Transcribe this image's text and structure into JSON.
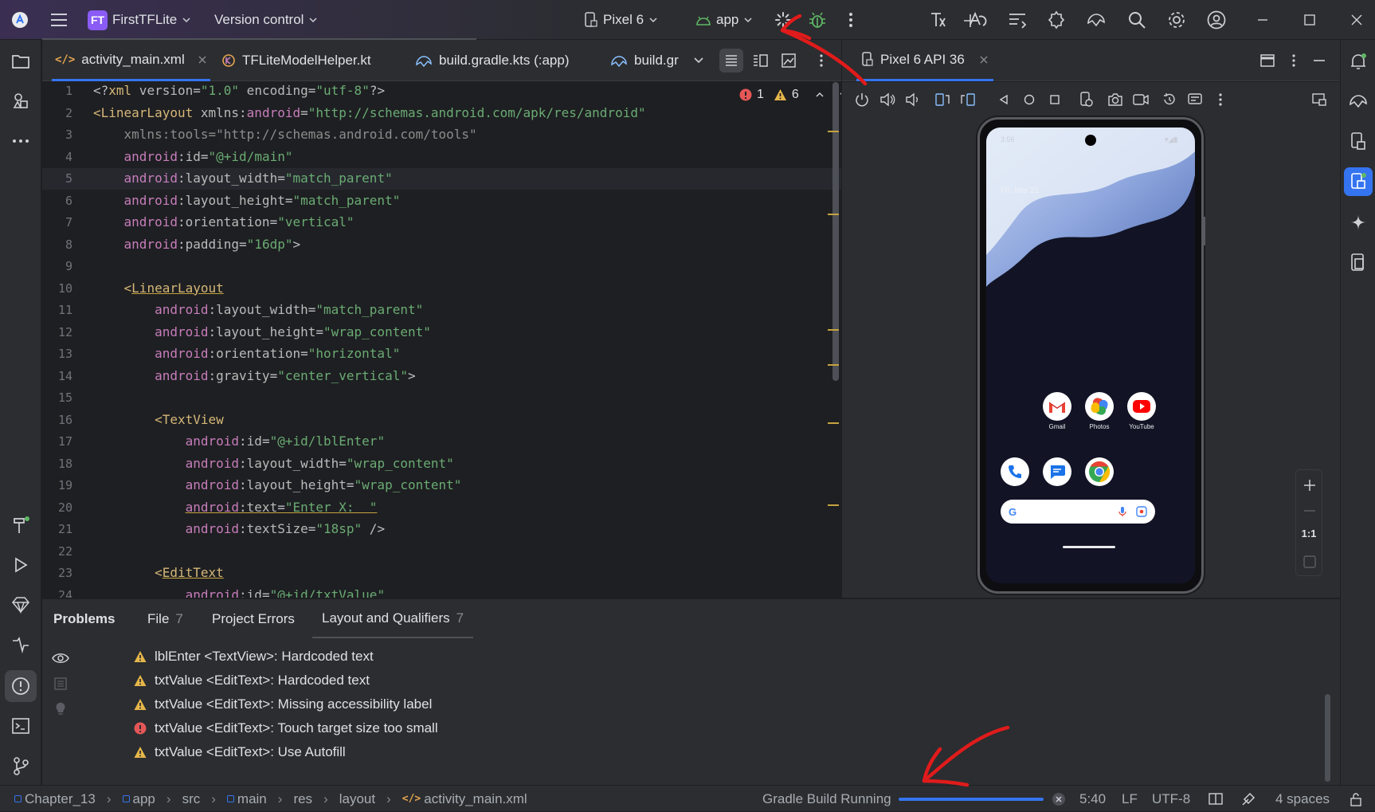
{
  "title_bar": {
    "project_badge": "FT",
    "project_name": "FirstTFLite",
    "vcs_label": "Version control",
    "device_label": "Pixel 6",
    "run_config_label": "app"
  },
  "editor": {
    "tabs": [
      {
        "label": "activity_main.xml",
        "active": true
      },
      {
        "label": "TFLiteModelHelper.kt",
        "active": false
      },
      {
        "label": "build.gradle.kts (:app)",
        "active": false
      },
      {
        "label": "build.gr",
        "active": false
      }
    ],
    "error_count": "1",
    "warning_count": "6",
    "lines": [
      {
        "n": "1",
        "segs": [
          [
            "p",
            "<?"
          ],
          [
            "t",
            "xml"
          ],
          [
            "a",
            " version"
          ],
          [
            "p",
            "="
          ],
          [
            "s",
            "\"1.0\""
          ],
          [
            "a",
            " encoding"
          ],
          [
            "p",
            "="
          ],
          [
            "s",
            "\"utf-8\""
          ],
          [
            "p",
            "?>"
          ]
        ]
      },
      {
        "n": "2",
        "segs": [
          [
            "t",
            "<LinearLayout"
          ],
          [
            "a",
            " xmlns:"
          ],
          [
            "ns",
            "android"
          ],
          [
            "p",
            "="
          ],
          [
            "s",
            "\"http://schemas.android.com/apk/res/android\""
          ]
        ]
      },
      {
        "n": "3",
        "segs": [
          [
            "g",
            "    xmlns:tools=\"http://schemas.android.com/tools\""
          ]
        ]
      },
      {
        "n": "4",
        "segs": [
          [
            "ns",
            "    android"
          ],
          [
            "a",
            ":id"
          ],
          [
            "p",
            "="
          ],
          [
            "s",
            "\"@+id/main\""
          ]
        ]
      },
      {
        "n": "5",
        "segs": [
          [
            "ns",
            "    android"
          ],
          [
            "a",
            ":layout_width"
          ],
          [
            "p",
            "="
          ],
          [
            "s",
            "\"match_parent\""
          ]
        ]
      },
      {
        "n": "6",
        "segs": [
          [
            "ns",
            "    android"
          ],
          [
            "a",
            ":layout_height"
          ],
          [
            "p",
            "="
          ],
          [
            "s",
            "\"match_parent\""
          ]
        ]
      },
      {
        "n": "7",
        "segs": [
          [
            "ns",
            "    android"
          ],
          [
            "a",
            ":orientation"
          ],
          [
            "p",
            "="
          ],
          [
            "s",
            "\"vertical\""
          ]
        ]
      },
      {
        "n": "8",
        "segs": [
          [
            "ns",
            "    android"
          ],
          [
            "a",
            ":padding"
          ],
          [
            "p",
            "="
          ],
          [
            "s",
            "\"16dp\""
          ],
          [
            "p",
            ">"
          ]
        ]
      },
      {
        "n": "9",
        "segs": []
      },
      {
        "n": "10",
        "segs": [
          [
            "t",
            "    <"
          ],
          [
            "tu",
            "LinearLayout"
          ]
        ]
      },
      {
        "n": "11",
        "segs": [
          [
            "ns",
            "        android"
          ],
          [
            "a",
            ":layout_width"
          ],
          [
            "p",
            "="
          ],
          [
            "s",
            "\"match_parent\""
          ]
        ]
      },
      {
        "n": "12",
        "segs": [
          [
            "ns",
            "        android"
          ],
          [
            "a",
            ":layout_height"
          ],
          [
            "p",
            "="
          ],
          [
            "s",
            "\"wrap_content\""
          ]
        ]
      },
      {
        "n": "13",
        "segs": [
          [
            "ns",
            "        android"
          ],
          [
            "a",
            ":orientation"
          ],
          [
            "p",
            "="
          ],
          [
            "s",
            "\"horizontal\""
          ]
        ]
      },
      {
        "n": "14",
        "segs": [
          [
            "ns",
            "        android"
          ],
          [
            "a",
            ":gravity"
          ],
          [
            "p",
            "="
          ],
          [
            "s",
            "\"center_vertical\""
          ],
          [
            "p",
            ">"
          ]
        ]
      },
      {
        "n": "15",
        "segs": []
      },
      {
        "n": "16",
        "segs": [
          [
            "t",
            "        <TextView"
          ]
        ]
      },
      {
        "n": "17",
        "segs": [
          [
            "ns",
            "            android"
          ],
          [
            "a",
            ":id"
          ],
          [
            "p",
            "="
          ],
          [
            "s",
            "\"@+id/lblEnter\""
          ]
        ]
      },
      {
        "n": "18",
        "segs": [
          [
            "ns",
            "            android"
          ],
          [
            "a",
            ":layout_width"
          ],
          [
            "p",
            "="
          ],
          [
            "s",
            "\"wrap_content\""
          ]
        ]
      },
      {
        "n": "19",
        "segs": [
          [
            "ns",
            "            android"
          ],
          [
            "a",
            ":layout_height"
          ],
          [
            "p",
            "="
          ],
          [
            "s",
            "\"wrap_content\""
          ]
        ]
      },
      {
        "n": "20",
        "segs": [
          [
            "p",
            "            "
          ],
          [
            "nsu",
            "android"
          ],
          [
            "au",
            ":text"
          ],
          [
            "pu",
            "="
          ],
          [
            "su",
            "\"Enter X:  \""
          ]
        ]
      },
      {
        "n": "21",
        "segs": [
          [
            "ns",
            "            android"
          ],
          [
            "a",
            ":textSize"
          ],
          [
            "p",
            "="
          ],
          [
            "s",
            "\"18sp\""
          ],
          [
            "p",
            " />"
          ]
        ]
      },
      {
        "n": "22",
        "segs": []
      },
      {
        "n": "23",
        "segs": [
          [
            "t",
            "        <"
          ],
          [
            "tu",
            "EditText"
          ]
        ]
      },
      {
        "n": "24",
        "segs": [
          [
            "ns",
            "            android"
          ],
          [
            "a",
            ":id"
          ],
          [
            "p",
            "="
          ],
          [
            "s",
            "\"@+id/txtValue\""
          ]
        ]
      }
    ]
  },
  "emulator": {
    "tab_label": "Pixel 6 API 36",
    "phone_date": "Fri, Mar 21",
    "phone_time": "3:56",
    "apps_row1": [
      "Gmail",
      "Photos",
      "YouTube"
    ],
    "zoom_label": "1:1"
  },
  "problems": {
    "tabs": [
      {
        "label": "Problems",
        "count": ""
      },
      {
        "label": "File",
        "count": "7"
      },
      {
        "label": "Project Errors",
        "count": ""
      },
      {
        "label": "Layout and Qualifiers",
        "count": "7"
      }
    ],
    "items": [
      {
        "severity": "warning",
        "text": "lblEnter <TextView>: Hardcoded text"
      },
      {
        "severity": "warning",
        "text": "txtValue <EditText>: Hardcoded text"
      },
      {
        "severity": "warning",
        "text": "txtValue <EditText>: Missing accessibility label"
      },
      {
        "severity": "error",
        "text": "txtValue <EditText>: Touch target size too small"
      },
      {
        "severity": "warning",
        "text": "txtValue <EditText>: Use Autofill"
      }
    ]
  },
  "status_bar": {
    "breadcrumbs": [
      "Chapter_13",
      "app",
      "src",
      "main",
      "res",
      "layout",
      "activity_main.xml"
    ],
    "build_status": "Gradle Build Running",
    "build_progress": 1.0,
    "cursor_pos": "5:40",
    "line_ending": "LF",
    "encoding": "UTF-8",
    "indent": "4 spaces"
  },
  "colors": {
    "accent": "#3574f0",
    "warning": "#e5b64a",
    "error": "#e55757",
    "annotation": "#e01b1b"
  }
}
